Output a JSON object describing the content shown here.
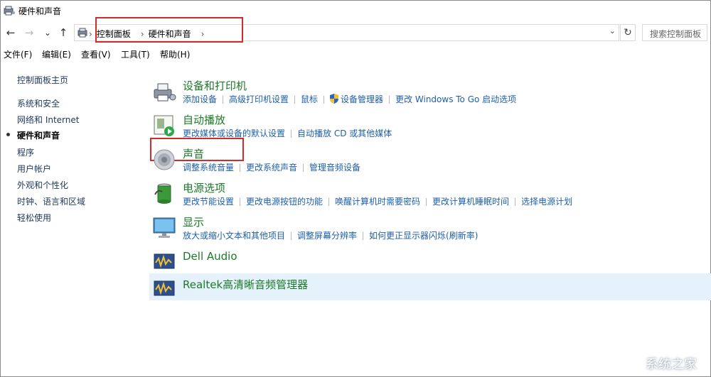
{
  "window": {
    "title": "硬件和声音"
  },
  "nav": {
    "back": "←",
    "forward": "→",
    "recent": "⌄",
    "up": "↑",
    "breadcrumb": [
      "控制面板",
      "硬件和声音"
    ],
    "separator": "›",
    "dropdown": "⌄",
    "refresh": "↻",
    "search_placeholder": "搜索控制面板"
  },
  "menu": [
    "文件(F)",
    "编辑(E)",
    "查看(V)",
    "工具(T)",
    "帮助(H)"
  ],
  "sidebar": {
    "home": "控制面板主页",
    "items": [
      "系统和安全",
      "网络和 Internet",
      "硬件和声音",
      "程序",
      "用户帐户",
      "外观和个性化",
      "时钟、语言和区域",
      "轻松使用"
    ],
    "active_index": 2
  },
  "categories": [
    {
      "title": "设备和打印机",
      "icon": "printer-icon",
      "links": [
        "添加设备",
        "高级打印机设置",
        "鼠标",
        "设备管理器",
        "更改 Windows To Go 启动选项"
      ]
    },
    {
      "title": "自动播放",
      "icon": "autoplay-icon",
      "links": [
        "更改媒体或设备的默认设置",
        "自动播放 CD 或其他媒体"
      ]
    },
    {
      "title": "声音",
      "icon": "speaker-icon",
      "links": [
        "调整系统音量",
        "更改系统声音",
        "管理音频设备"
      ]
    },
    {
      "title": "电源选项",
      "icon": "battery-icon",
      "links": [
        "更改节能设置",
        "更改电源按钮的功能",
        "唤醒计算机时需要密码",
        "更改计算机睡眠时间",
        "选择电源计划"
      ]
    },
    {
      "title": "显示",
      "icon": "monitor-icon",
      "links": [
        "放大或缩小文本和其他项目",
        "调整屏幕分辨率",
        "如何更正显示器闪烁(刷新率)"
      ]
    },
    {
      "title": "Dell Audio",
      "icon": "dell-audio-icon",
      "links": []
    },
    {
      "title": "Realtek高清晰音频管理器",
      "icon": "realtek-audio-icon",
      "links": []
    }
  ],
  "watermark": "系统之家",
  "colors": {
    "highlight_box": "#d32a2a",
    "title_green": "#1b7a27",
    "link_blue": "#1e5fa8",
    "selected_bg": "#e5f1fb"
  }
}
